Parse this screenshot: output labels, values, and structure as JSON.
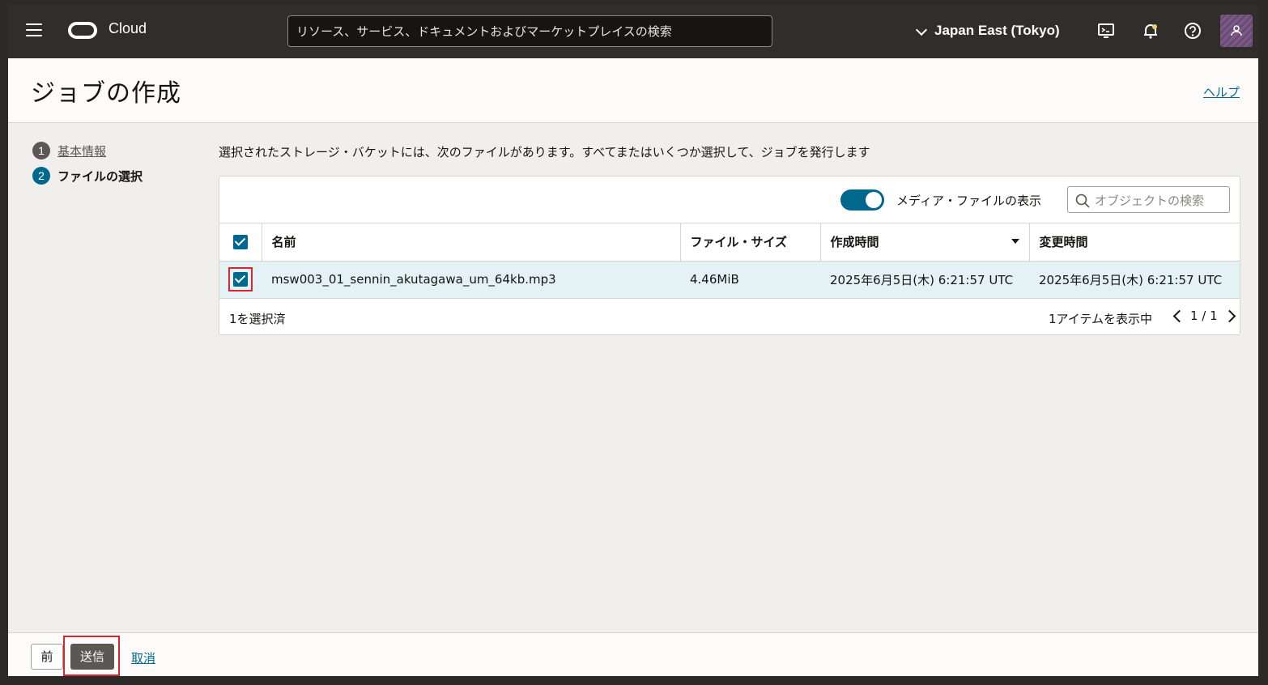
{
  "header": {
    "brand": "Cloud",
    "search_placeholder": "リソース、サービス、ドキュメントおよびマーケットプレイスの検索",
    "region": "Japan East (Tokyo)"
  },
  "page": {
    "title": "ジョブの作成",
    "help": "ヘルプ"
  },
  "steps": [
    {
      "num": "1",
      "label": "基本情報"
    },
    {
      "num": "2",
      "label": "ファイルの選択"
    }
  ],
  "description": "選択されたストレージ・バケットには、次のファイルがあります。すべてまたはいくつか選択して、ジョブを発行します",
  "toolbar": {
    "toggle_label": "メディア・ファイルの表示",
    "toggle_on": true,
    "search_placeholder": "オブジェクトの検索"
  },
  "table": {
    "columns": [
      "名前",
      "ファイル・サイズ",
      "作成時間",
      "変更時間"
    ],
    "rows": [
      {
        "name": "msw003_01_sennin_akutagawa_um_64kb.mp3",
        "size": "4.46MiB",
        "created": "2025年6月5日(木) 6:21:57 UTC",
        "modified": "2025年6月5日(木) 6:21:57 UTC",
        "selected": true
      }
    ]
  },
  "table_footer": {
    "selected_count": "1を選択済",
    "items_shown": "1アイテムを表示中",
    "page": "1 / 1"
  },
  "actions": {
    "prev": "前",
    "submit": "送信",
    "cancel": "取消"
  },
  "colors": {
    "header_bg": "#312d2a",
    "accent": "#00688c",
    "highlight_border": "#d7262c"
  }
}
